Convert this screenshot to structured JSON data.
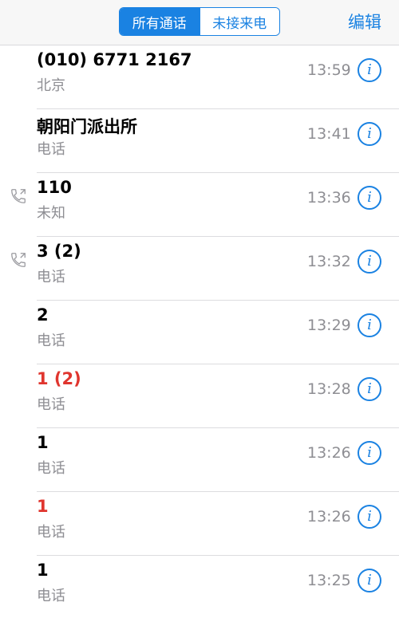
{
  "header": {
    "tabs": [
      {
        "label": "所有通话",
        "active": true
      },
      {
        "label": "未接来电",
        "active": false
      }
    ],
    "edit_label": "编辑"
  },
  "calls": [
    {
      "name": "(010) 6771 2167",
      "subtitle": "北京",
      "time": "13:59",
      "missed": false,
      "outgoing": false
    },
    {
      "name": "朝阳门派出所",
      "subtitle": "电话",
      "time": "13:41",
      "missed": false,
      "outgoing": false
    },
    {
      "name": "110",
      "subtitle": "未知",
      "time": "13:36",
      "missed": false,
      "outgoing": true
    },
    {
      "name": "3 (2)",
      "subtitle": "电话",
      "time": "13:32",
      "missed": false,
      "outgoing": true
    },
    {
      "name": "2",
      "subtitle": "电话",
      "time": "13:29",
      "missed": false,
      "outgoing": false
    },
    {
      "name": "1 (2)",
      "subtitle": "电话",
      "time": "13:28",
      "missed": true,
      "outgoing": false
    },
    {
      "name": "1",
      "subtitle": "电话",
      "time": "13:26",
      "missed": false,
      "outgoing": false
    },
    {
      "name": "1",
      "subtitle": "电话",
      "time": "13:26",
      "missed": true,
      "outgoing": false
    },
    {
      "name": "1",
      "subtitle": "电话",
      "time": "13:25",
      "missed": false,
      "outgoing": false
    }
  ],
  "info_glyph": "i",
  "colors": {
    "accent": "#1a82e2",
    "missed": "#e0352e",
    "secondary_text": "#8e8e93"
  }
}
